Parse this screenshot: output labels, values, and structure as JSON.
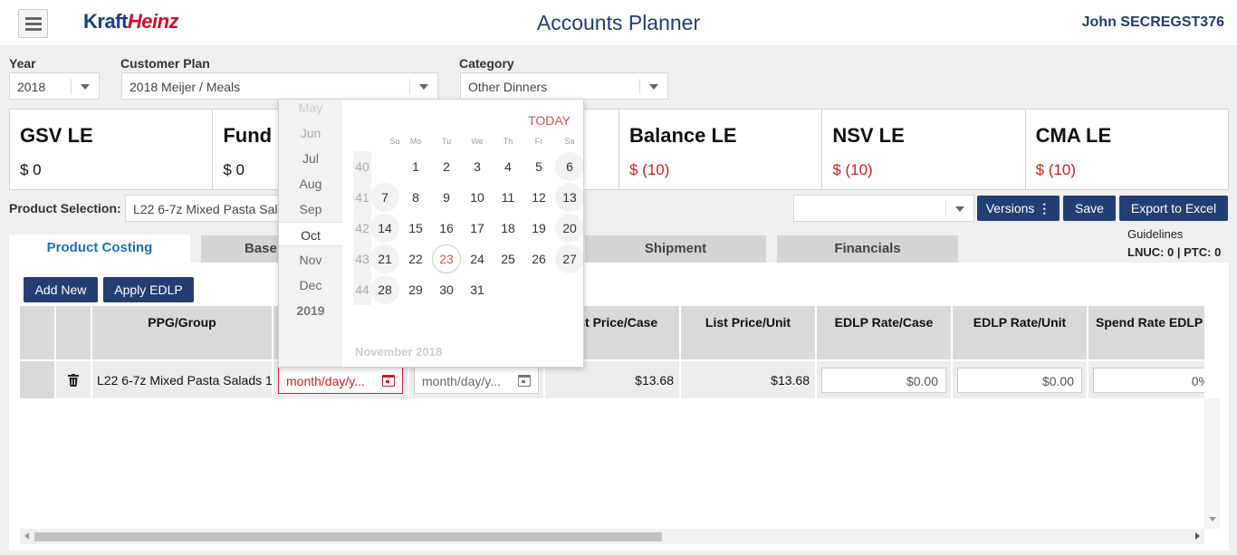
{
  "header": {
    "title": "Accounts Planner",
    "user": "John SECREGST376",
    "logo_a": "Kraft",
    "logo_b": "Heinz",
    "menu_icon": "hamburger-icon"
  },
  "filters": {
    "year": {
      "label": "Year",
      "value": "2018"
    },
    "customer_plan": {
      "label": "Customer Plan",
      "value": "2018 Meijer / Meals"
    },
    "category": {
      "label": "Category",
      "value": "Other Dinners"
    }
  },
  "kpis": [
    {
      "title": "GSV LE",
      "value": "$ 0",
      "negative": false
    },
    {
      "title": "Fund LE",
      "value": "$ 0",
      "negative": false
    },
    {
      "title": "",
      "value": "",
      "negative": false
    },
    {
      "title": "Balance LE",
      "value": "$ (10)",
      "negative": true
    },
    {
      "title": "NSV LE",
      "value": "$ (10)",
      "negative": true
    },
    {
      "title": "CMA LE",
      "value": "$ (10)",
      "negative": true
    }
  ],
  "product_selection": {
    "label": "Product Selection:",
    "value": "L22 6-7z Mixed Pasta Salads"
  },
  "toolbar": {
    "versions": "Versions",
    "save": "Save",
    "export": "Export to Excel",
    "version_select": ""
  },
  "tabs": [
    "Product Costing",
    "Base",
    "Shipment",
    "Financials"
  ],
  "guidelines": {
    "title": "Guidelines",
    "values": "LNUC: 0 | PTC: 0"
  },
  "actions": {
    "add_new": "Add New",
    "apply_edlp": "Apply EDLP"
  },
  "grid": {
    "columns": [
      "PPG/Group",
      "",
      "",
      "List Price/Case",
      "List Price/Unit",
      "EDLP Rate/Case",
      "EDLP Rate/Unit",
      "Spend Rate EDLP"
    ],
    "row": {
      "ppg": "L22 6-7z Mixed Pasta Salads 1",
      "start_date": "month/day/y...",
      "end_date": "month/day/y...",
      "list_price_case": "$13.68",
      "list_price_unit": "$13.68",
      "edlp_rate_case": "$0.00",
      "edlp_rate_unit": "$0.00",
      "spend_rate": "0%"
    }
  },
  "datepicker": {
    "months": [
      "May",
      "Jun",
      "Jul",
      "Aug",
      "Sep",
      "Oct",
      "Nov",
      "Dec"
    ],
    "selected_month": "Oct",
    "next_year": "2019",
    "today_label": "TODAY",
    "weekdays": [
      "Su",
      "Mo",
      "Tu",
      "We",
      "Th",
      "Fr",
      "Sa"
    ],
    "weeks": [
      {
        "wk": "40",
        "days": [
          "",
          "1",
          "2",
          "3",
          "4",
          "5",
          "6"
        ]
      },
      {
        "wk": "41",
        "days": [
          "7",
          "8",
          "9",
          "10",
          "11",
          "12",
          "13"
        ]
      },
      {
        "wk": "42",
        "days": [
          "14",
          "15",
          "16",
          "17",
          "18",
          "19",
          "20"
        ]
      },
      {
        "wk": "43",
        "days": [
          "21",
          "22",
          "23",
          "24",
          "25",
          "26",
          "27"
        ]
      },
      {
        "wk": "44",
        "days": [
          "28",
          "29",
          "30",
          "31",
          "",
          "",
          ""
        ]
      }
    ],
    "today_day": "23",
    "next_month_label": "November 2018"
  }
}
